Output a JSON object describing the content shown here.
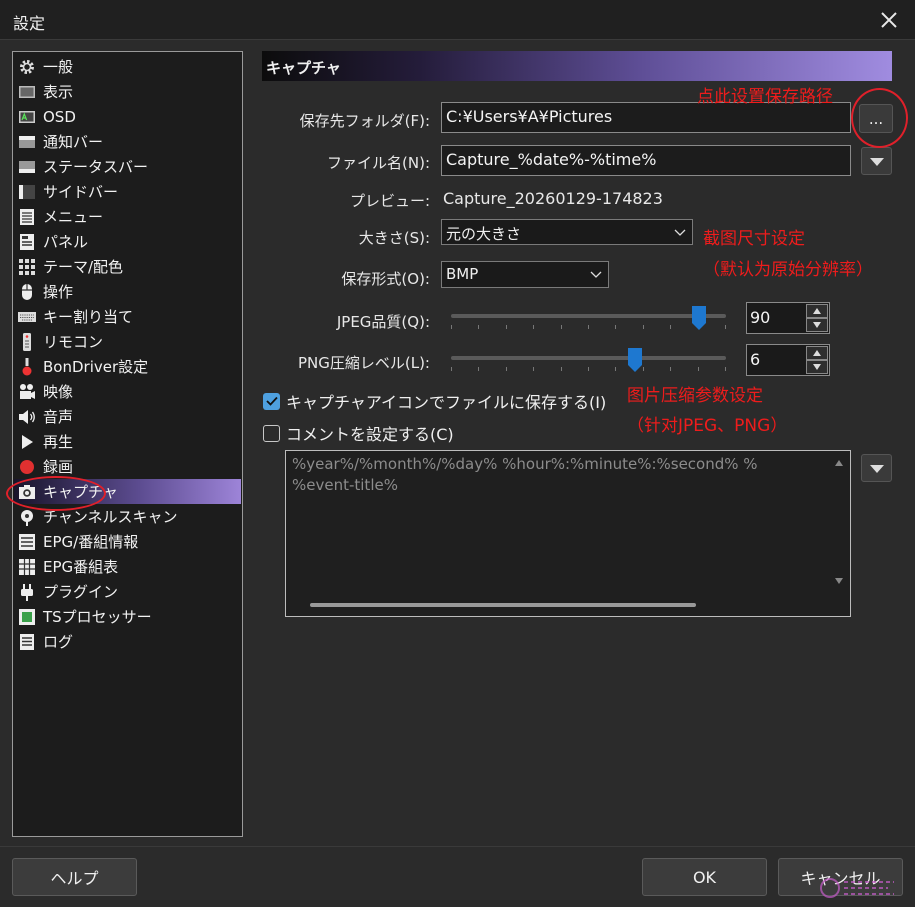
{
  "window": {
    "title": "設定"
  },
  "sidebar": {
    "items": [
      {
        "label": "一般",
        "icon": "gear-icon"
      },
      {
        "label": "表示",
        "icon": "display-icon"
      },
      {
        "label": "OSD",
        "icon": "osd-icon"
      },
      {
        "label": "通知バー",
        "icon": "notification-bar-icon"
      },
      {
        "label": "ステータスバー",
        "icon": "status-bar-icon"
      },
      {
        "label": "サイドバー",
        "icon": "sidebar-icon"
      },
      {
        "label": "メニュー",
        "icon": "menu-icon"
      },
      {
        "label": "パネル",
        "icon": "panel-icon"
      },
      {
        "label": "テーマ/配色",
        "icon": "theme-icon"
      },
      {
        "label": "操作",
        "icon": "mouse-icon"
      },
      {
        "label": "キー割り当て",
        "icon": "keyboard-icon"
      },
      {
        "label": "リモコン",
        "icon": "remote-icon"
      },
      {
        "label": "BonDriver設定",
        "icon": "bondriver-icon"
      },
      {
        "label": "映像",
        "icon": "video-camera-icon"
      },
      {
        "label": "音声",
        "icon": "speaker-icon"
      },
      {
        "label": "再生",
        "icon": "play-icon"
      },
      {
        "label": "録画",
        "icon": "record-icon"
      },
      {
        "label": "キャプチャ",
        "icon": "camera-icon",
        "selected": true
      },
      {
        "label": "チャンネルスキャン",
        "icon": "scan-icon"
      },
      {
        "label": "EPG/番組情報",
        "icon": "epg-icon"
      },
      {
        "label": "EPG番組表",
        "icon": "program-guide-icon"
      },
      {
        "label": "プラグイン",
        "icon": "plugin-icon"
      },
      {
        "label": "TSプロセッサー",
        "icon": "ts-processor-icon"
      },
      {
        "label": "ログ",
        "icon": "log-icon"
      }
    ]
  },
  "capture": {
    "header": "キャプチャ",
    "save_folder_label": "保存先フォルダ(F):",
    "save_folder_value": "C:¥Users¥A¥Pictures",
    "browse_label": "...",
    "filename_label": "ファイル名(N):",
    "filename_value": "Capture_%date%-%time%",
    "preview_label": "プレビュー:",
    "preview_value": "Capture_20260129-174823",
    "size_label": "大きさ(S):",
    "size_value": "元の大きさ",
    "format_label": "保存形式(O):",
    "format_value": "BMP",
    "jpeg_label": "JPEG品質(Q):",
    "jpeg_value": "90",
    "jpeg_fraction": 0.9,
    "png_label": "PNG圧縮レベル(L):",
    "png_value": "6",
    "png_fraction": 0.67,
    "icon_save_label": "キャプチャアイコンでファイルに保存する(I)",
    "icon_save_checked": true,
    "comment_label": "コメントを設定する(C)",
    "comment_checked": false,
    "comment_text_1": "%year%/%month%/%day% %hour%:%minute%:%second% %",
    "comment_text_2": "%event-title%"
  },
  "annotations": {
    "path": "点此设置保存路径",
    "size_1": "截图尺寸设定",
    "size_2": "（默认为原始分辨率）",
    "compress_1": "图片压缩参数设定",
    "compress_2": "（针对JPEG、PNG）"
  },
  "footer": {
    "help": "ヘルプ",
    "ok": "OK",
    "cancel": "キャンセル"
  },
  "colors": {
    "accent": "#4ea0e0",
    "annotation": "#ee1c1c",
    "selection": "#9d84d8"
  }
}
